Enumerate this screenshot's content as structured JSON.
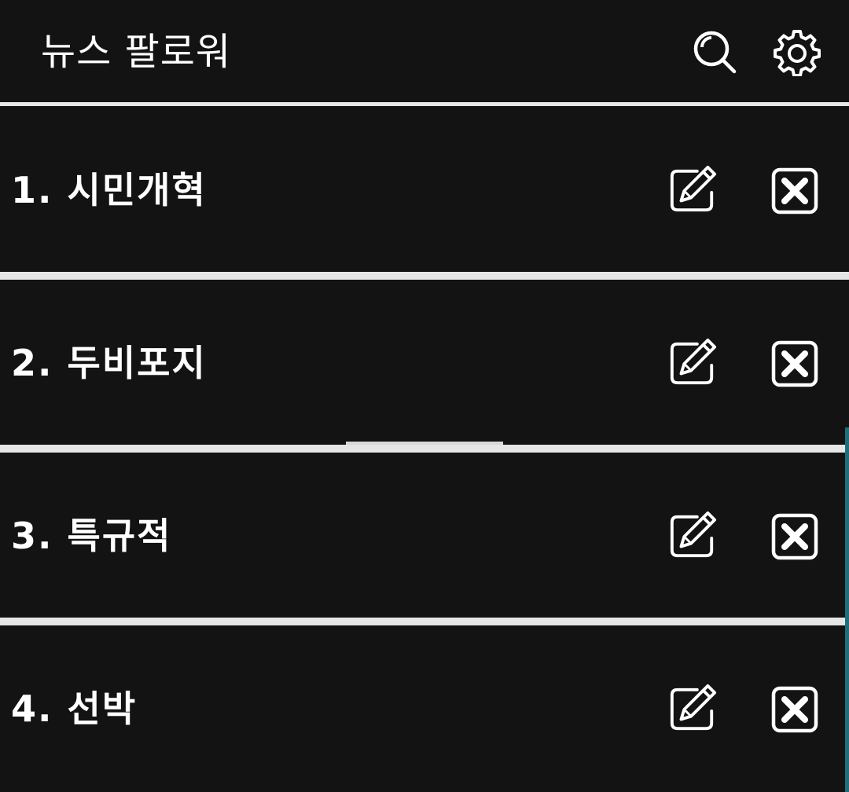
{
  "header": {
    "title": "뉴스 팔로워",
    "search_icon": "search-icon",
    "settings_icon": "gear-icon"
  },
  "items": [
    {
      "label": "1. 시민개혁",
      "edit_icon": "edit-icon",
      "delete_icon": "close-box-icon"
    },
    {
      "label": "2. 두비포지",
      "edit_icon": "edit-icon",
      "delete_icon": "close-box-icon"
    },
    {
      "label": "3. 특규적",
      "edit_icon": "edit-icon",
      "delete_icon": "close-box-icon"
    },
    {
      "label": "4. 선박",
      "edit_icon": "edit-icon",
      "delete_icon": "close-box-icon"
    }
  ],
  "colors": {
    "background": "#131313",
    "divider": "#e6e6e6",
    "text": "#ffffff",
    "scroll_indicator": "#1f6f7a"
  }
}
